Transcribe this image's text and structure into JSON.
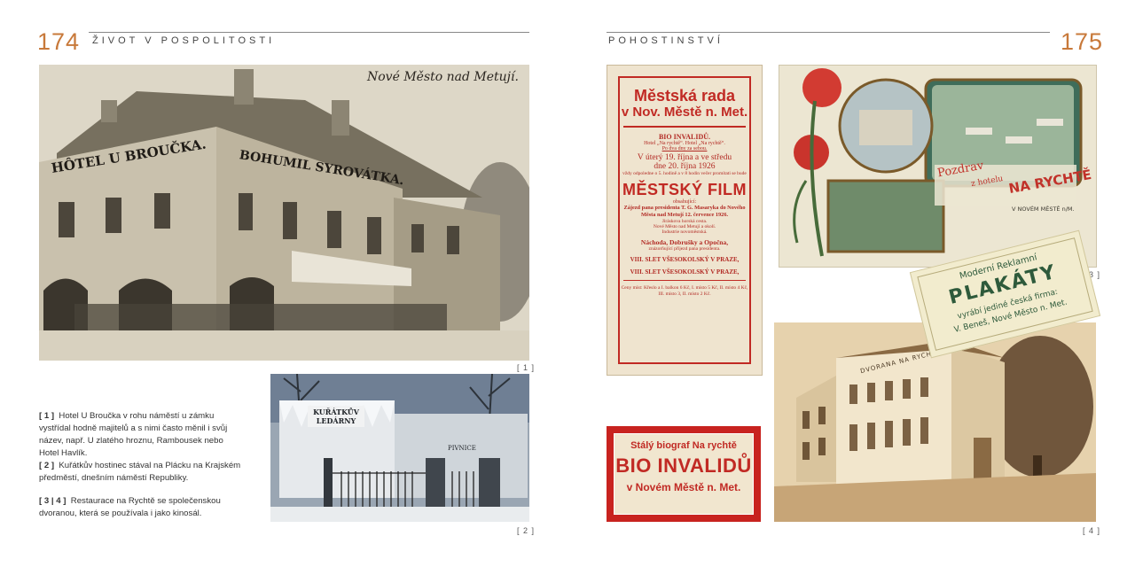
{
  "left_page": {
    "number": "174",
    "section": "ŽIVOT V POSPOLITOSTI",
    "photo1": {
      "inscription": "Nové Město nad Metují.",
      "sign1": "HÔTEL U BROUČKA.",
      "sign2": "BOHUMIL SYROVÁTKA.",
      "label": "[ 1 ]"
    },
    "photo2": {
      "sign1": "KUŘÁTKŮV LEDÁRNY",
      "sign2": "PIVNICE",
      "label": "[ 2 ]"
    },
    "captions": [
      {
        "num": "[ 1 ]",
        "text": "Hotel U Broučka v rohu náměstí u zámku vystřídal hodně majitelů a s nimi často měnil i svůj název, např. U zlatého hroznu, Rambousek nebo Hotel Havlík."
      },
      {
        "num": "[ 2 ]",
        "text": "Kuřátkův hostinec stával na Plácku na Krajském předměstí, dnešním náměstí Republiky."
      },
      {
        "num": "[ 3 | 4 ]",
        "text": "Restaurace na Rychtě se společenskou dvoranou, která se používala i jako kinosál."
      }
    ]
  },
  "right_page": {
    "number": "175",
    "section": "POHOSTINSTVÍ",
    "poster": {
      "title1": "Městská rada",
      "title2": "v Nov. Městě n. Met.",
      "line1": "BIO INVALIDŮ.",
      "line2": "Hotel „Na rychtě“.   Hotel „Na rychtě“.",
      "line3": "Po dva dny za sebou.",
      "line4": "V úterý 19. října a ve středu",
      "line5": "dne 20. října 1926",
      "line6": "vždy odpoledne o 5. hodině a v 8 hodin večer promítati se bude",
      "film": "MĚSTSKÝ FILM",
      "contains": "obsahující:",
      "line7": "Zájezd pana presidenta T. G. Masaryka do Nového Města nad Metují 12. července 1926.",
      "line8": "Jiráskova horská cesta.",
      "line9": "Nové Město nad Metují a okolí.",
      "line10": "Industrie novoměstská.",
      "line11": "Náchoda, Dobrušky a Opočna,",
      "line12": "znázorňující příjezd pana presidenta.",
      "line13": "VIII. SLET VŠESOKOLSKÝ V PRAZE,",
      "line14": "VIII. SLET VŠESOKOLSKÝ V PRAZE,",
      "line15": "Ceny míst: Křeslo a I. balkon 6 Kč, I. místo 5 Kč, II. místo 4 Kč, III. místo 3, II. místo 2 Kč."
    },
    "postcard": {
      "greeting": "Pozdrav",
      "from": "z hotelu",
      "name": "NA RYCHTĚ",
      "place": "V NOVÉM MĚSTĚ n/M.",
      "label": "[ 3 ]"
    },
    "adcard": {
      "line1": "Moderní Reklamní",
      "line2": "PLAKÁTY",
      "line3": "vyrábí jediné česká firma:",
      "line4": "V. Beneš, Nové Město n. Met."
    },
    "ticket": {
      "line1": "Stálý biograf Na rychtě",
      "line2": "BIO INVALIDŮ",
      "line3": "v Novém Městě n. Met."
    },
    "photo4": {
      "sign": "DVORANA NA RYCHTĚ",
      "label": "[ 4 ]"
    }
  },
  "colors": {
    "accent": "#c8793a",
    "poster_red": "#c12a24"
  }
}
